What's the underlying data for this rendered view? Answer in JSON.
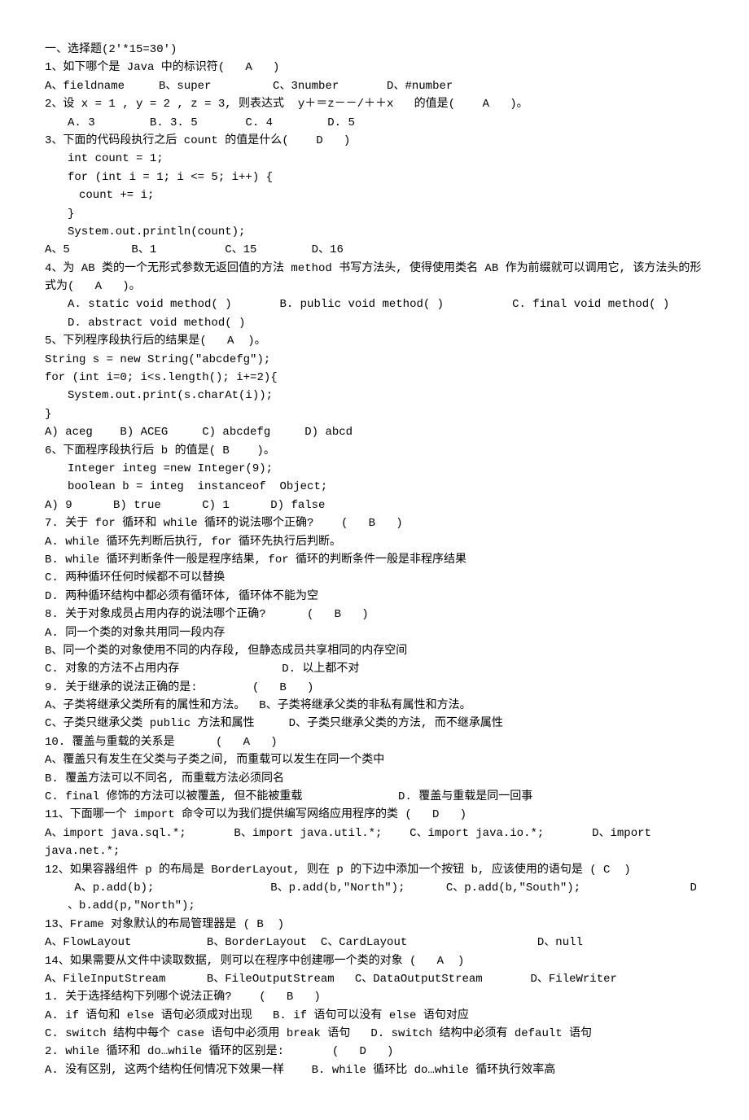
{
  "lines": [
    {
      "t": "一、选择题(2'*15=30')"
    },
    {
      "t": "1、如下哪个是 Java 中的标识符(   A   )"
    },
    {
      "t": "A、fieldname     B、super         C、3number       D、#number"
    },
    {
      "t": "2、设 x = 1 , y = 2 , z = 3, 则表达式  y＋＝z－－/＋＋x   的值是(    A   )。"
    },
    {
      "t": "A. 3        B. 3. 5       C. 4        D. 5",
      "cls": "indent1"
    },
    {
      "t": "3、下面的代码段执行之后 count 的值是什么(    D   )"
    },
    {
      "t": "int count = 1;",
      "cls": "indent1"
    },
    {
      "t": "for (int i = 1; i <= 5; i++) {",
      "cls": "indent1"
    },
    {
      "t": "count += i;",
      "cls": "indent2"
    },
    {
      "t": "}",
      "cls": "indent1"
    },
    {
      "t": "System.out.println(count);",
      "cls": "indent1"
    },
    {
      "t": "A、5         B、1          C、15        D、16"
    },
    {
      "t": "4、为 AB 类的一个无形式参数无返回值的方法 method 书写方法头, 使得使用类名 AB 作为前缀就可以调用它, 该方法头的形式为(   A   )。"
    },
    {
      "t": "A. static void method( )       B. public void method( )          C. final void method( )        D. abstract void method( )",
      "cls": "indent1"
    },
    {
      "t": "5、下列程序段执行后的结果是(   A  )。"
    },
    {
      "t": "String s = new String(\"abcdefg\");"
    },
    {
      "t": "for (int i=0; i<s.length(); i+=2){"
    },
    {
      "t": "System.out.print(s.charAt(i));",
      "cls": "indent1"
    },
    {
      "t": "}"
    },
    {
      "t": "A) aceg    B) ACEG     C) abcdefg     D) abcd"
    },
    {
      "t": "6、下面程序段执行后 b 的值是( B    )。"
    },
    {
      "t": "Integer integ =new Integer(9);",
      "cls": "indent1"
    },
    {
      "t": "boolean b = integ  instanceof  Object;",
      "cls": "indent1"
    },
    {
      "t": "A) 9      B) true      C) 1      D) false"
    },
    {
      "t": "7. 关于 for 循环和 while 循环的说法哪个正确?    (   B   )"
    },
    {
      "t": "A. while 循环先判断后执行, for 循环先执行后判断。"
    },
    {
      "t": "B. while 循环判断条件一般是程序结果, for 循环的判断条件一般是非程序结果"
    },
    {
      "t": "C. 两种循环任何时候都不可以替换"
    },
    {
      "t": "D. 两种循环结构中都必须有循环体, 循环体不能为空"
    },
    {
      "t": "8. 关于对象成员占用内存的说法哪个正确?      (   B   )"
    },
    {
      "t": "A. 同一个类的对象共用同一段内存"
    },
    {
      "t": "B、同一个类的对象使用不同的内存段, 但静态成员共享相同的内存空间"
    },
    {
      "t": "C. 对象的方法不占用内存               D. 以上都不对"
    },
    {
      "t": "9. 关于继承的说法正确的是:        (   B   )"
    },
    {
      "t": "A、子类将继承父类所有的属性和方法。  B、子类将继承父类的非私有属性和方法。"
    },
    {
      "t": "C、子类只继承父类 public 方法和属性     D、子类只继承父类的方法, 而不继承属性"
    },
    {
      "t": "10. 覆盖与重载的关系是      (   A   )"
    },
    {
      "t": "A、覆盖只有发生在父类与子类之间, 而重载可以发生在同一个类中"
    },
    {
      "t": "B. 覆盖方法可以不同名, 而重载方法必须同名"
    },
    {
      "t": "C. final 修饰的方法可以被覆盖, 但不能被重载              D. 覆盖与重载是同一回事"
    },
    {
      "t": "11、下面哪一个 import 命令可以为我们提供编写网络应用程序的类 (   D   )"
    },
    {
      "t": "A、import java.sql.*;       B、import java.util.*;    C、import java.io.*;       D、import java.net.*;"
    },
    {
      "t": "12、如果容器组件 p 的布局是 BorderLayout, 则在 p 的下边中添加一个按钮 b, 应该使用的语句是 ( C  )"
    },
    {
      "t": " A、p.add(b);                 B、p.add(b,\"North\");      C、p.add(b,\"South\");                D      、b.add(p,\"North\");",
      "cls": "indent1"
    },
    {
      "t": "13、Frame 对象默认的布局管理器是 ( B  )"
    },
    {
      "t": "A、FlowLayout           B、BorderLayout  C、CardLayout                   D、null"
    },
    {
      "t": "14、如果需要从文件中读取数据, 则可以在程序中创建哪一个类的对象 (   A  )"
    },
    {
      "t": "A、FileInputStream      B、FileOutputStream   C、DataOutputStream       D、FileWriter"
    },
    {
      "t": "1. 关于选择结构下列哪个说法正确?    (   B   )"
    },
    {
      "t": "A. if 语句和 else 语句必须成对出现   B. if 语句可以没有 else 语句对应"
    },
    {
      "t": "C. switch 结构中每个 case 语句中必须用 break 语句   D. switch 结构中必须有 default 语句"
    },
    {
      "t": "2. while 循环和 do…while 循环的区别是:       (   D   )"
    },
    {
      "t": "A. 没有区别, 这两个结构任何情况下效果一样    B. while 循环比 do…while 循环执行效率高"
    }
  ]
}
